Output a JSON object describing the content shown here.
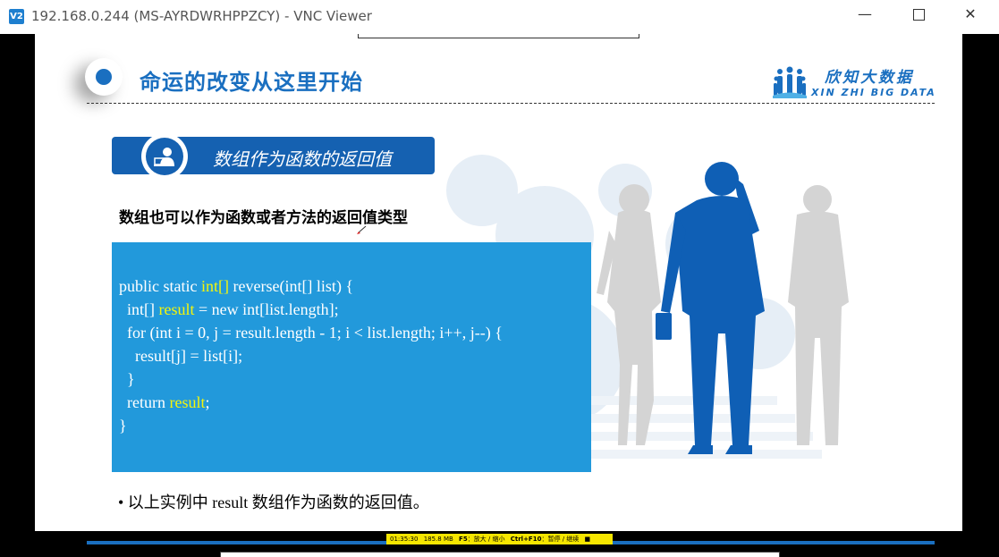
{
  "window": {
    "icon_label": "V2",
    "title": "192.168.0.244 (MS-AYRDWRHPPZCY) - VNC Viewer",
    "minimize_glyph": "—",
    "close_glyph": "✕"
  },
  "slide": {
    "title": "命运的改变从这里开始",
    "brand": {
      "cn": "欣知大数据",
      "en": "XIN ZHI BIG DATA"
    },
    "section_title": "数组作为函数的返回值",
    "subtitle": "数组也可以作为函数或者方法的返回值类型",
    "code": {
      "line1": {
        "a": "public static ",
        "b": "int[]",
        "c": " reverse(int[] list) {"
      },
      "line2": {
        "a": "  int[] ",
        "b": "result",
        "c": " = new int[list.length];"
      },
      "line3": "  for (int i = 0, j = result.length - 1; i < list.length; i++, j--) {",
      "line4": "    result[j] = list[i];",
      "line5": "  }",
      "line6": {
        "a": "  return ",
        "b": "result",
        "c": ";"
      },
      "line7": "}"
    },
    "bullet": "• 以上实例中 result 数组作为函数的返回值。"
  },
  "status": {
    "time": "01:35:30",
    "memory": "185.8 MB",
    "f5_key": "F5",
    "f5_desc": "：放大 / 缩小",
    "ctrl_key": "Ctrl+F10",
    "ctrl_desc": "：暂停 / 继续",
    "stop_glyph": "■"
  },
  "colors": {
    "accent": "#1a6fc0",
    "code_bg": "#2299db",
    "highlight": "#f5f50a",
    "status_bg": "#f6e600"
  }
}
